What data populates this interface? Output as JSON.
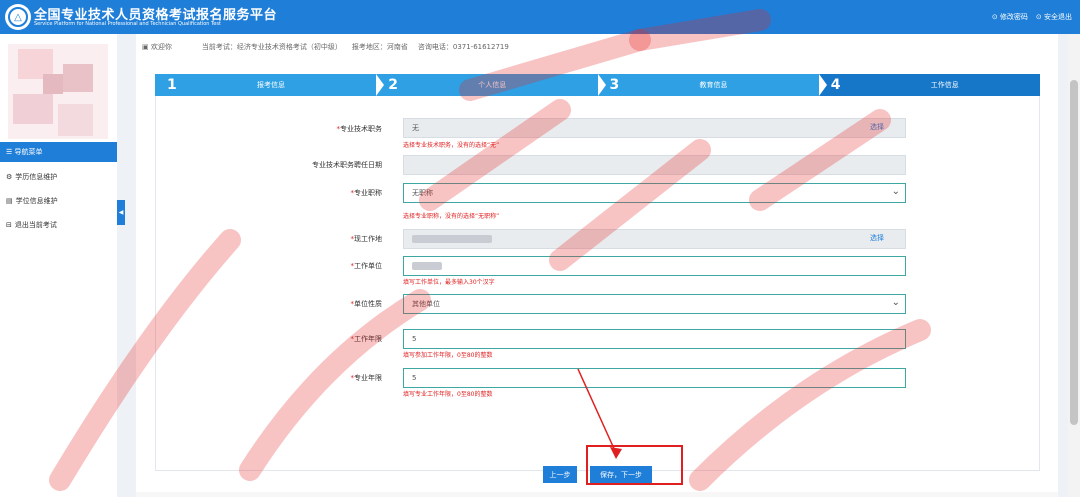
{
  "header": {
    "title_cn": "全国专业技术人员资格考试报名服务平台",
    "title_en": "Service Platform for National Professional and Technician Qualification Test",
    "links": [
      "⊙ 修改密码",
      "⊙ 安全退出"
    ]
  },
  "sidebar": {
    "nav_title": "☰ 导航菜单",
    "items": [
      "学历信息维护",
      "学位信息维护",
      "退出当前考试"
    ]
  },
  "info_bar": {
    "welcome": "欢迎你",
    "exam": "当前考试：经济专业技术资格考试（初中级）",
    "region": "报考地区：河南省",
    "phone": "咨询电话：0371-61612719"
  },
  "steps": [
    {
      "num": "1",
      "label": "报考信息"
    },
    {
      "num": "2",
      "label": "个人信息"
    },
    {
      "num": "3",
      "label": "教育信息"
    },
    {
      "num": "4",
      "label": "工作信息"
    }
  ],
  "form": {
    "title_label": "专业技术职务",
    "title_value": "无",
    "title_hint": "选择专业技术职务，没有的选择“无”",
    "pick_label": "选择",
    "date_label": "专业技术职务聘任日期",
    "prof_label": "专业职称",
    "prof_value": "无职称",
    "prof_hint": "选择专业职称，没有的选择“无职称”",
    "workplace_label": "现工作地",
    "unit_label": "工作单位",
    "unit_hint": "填写工作单位，最多输入30个汉字",
    "nature_label": "单位性质",
    "nature_value": "其他单位",
    "years_label": "工作年限",
    "years_value": "5",
    "years_hint": "填写参加工作年限，0至80的整数",
    "prof_years_label": "专业年限",
    "prof_years_value": "5",
    "prof_years_hint": "填写专业工作年限，0至80的整数"
  },
  "buttons": {
    "prev": "上一步",
    "next": "保存，下一步"
  },
  "colors": {
    "brand": "#1e7ed8",
    "step": "#2ea0e3",
    "step_active": "#1677c8",
    "error": "#e02020"
  }
}
